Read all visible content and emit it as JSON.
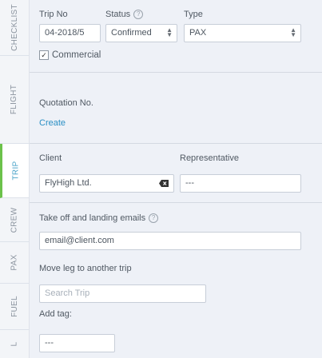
{
  "tabs": [
    {
      "label": "CHECKLIST",
      "active": false
    },
    {
      "label": "FLIGHT",
      "active": false
    },
    {
      "label": "TRIP",
      "active": true
    },
    {
      "label": "CREW",
      "active": false
    },
    {
      "label": "PAX",
      "active": false
    },
    {
      "label": "FUEL",
      "active": false
    },
    {
      "label": "L",
      "active": false
    }
  ],
  "trip": {
    "trip_no_label": "Trip No",
    "trip_no_value": "04-2018/5",
    "status_label": "Status",
    "status_value": "Confirmed",
    "type_label": "Type",
    "type_value": "PAX",
    "commercial_label": "Commercial",
    "commercial_checked": true,
    "quotation_label": "Quotation No.",
    "create_link": "Create",
    "client_label": "Client",
    "client_value": "FlyHigh Ltd.",
    "representative_label": "Representative",
    "representative_value": "---",
    "emails_label": "Take off and landing emails",
    "emails_value": "email@client.com",
    "move_leg_label": "Move leg to another trip",
    "search_trip_placeholder": "Search Trip",
    "add_tag_label": "Add tag:",
    "tag_value": "---"
  },
  "colors": {
    "accent_link": "#2a8fc4",
    "active_tab_marker": "#6cc24a",
    "panel_background": "#eef1f7"
  }
}
